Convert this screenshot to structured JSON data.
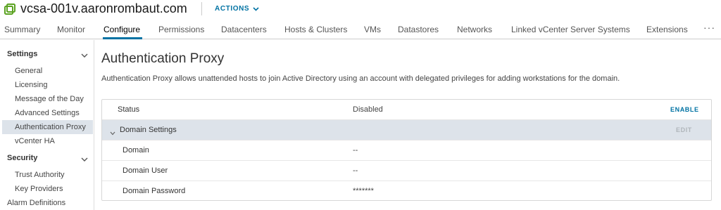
{
  "header": {
    "vm_icon": "vm-host-icon",
    "title": "vcsa-001v.aaronrombaut.com",
    "actions_label": "ACTIONS",
    "actions_icon": "chevron-down-icon"
  },
  "tabs": [
    {
      "label": "Summary"
    },
    {
      "label": "Monitor"
    },
    {
      "label": "Configure"
    },
    {
      "label": "Permissions"
    },
    {
      "label": "Datacenters"
    },
    {
      "label": "Hosts & Clusters"
    },
    {
      "label": "VMs"
    },
    {
      "label": "Datastores"
    },
    {
      "label": "Networks"
    },
    {
      "label": "Linked vCenter Server Systems"
    },
    {
      "label": "Extensions"
    }
  ],
  "tabs_more": "···",
  "active_tab": "Configure",
  "sidebar": {
    "settings_label": "Settings",
    "settings_items": [
      {
        "label": "General"
      },
      {
        "label": "Licensing"
      },
      {
        "label": "Message of the Day"
      },
      {
        "label": "Advanced Settings"
      },
      {
        "label": "Authentication Proxy"
      },
      {
        "label": "vCenter HA"
      }
    ],
    "security_label": "Security",
    "security_items": [
      {
        "label": "Trust Authority"
      },
      {
        "label": "Key Providers"
      }
    ],
    "alarm_label": "Alarm Definitions",
    "active_item": "Authentication Proxy"
  },
  "main": {
    "title": "Authentication Proxy",
    "description": "Authentication Proxy allows unattended hosts to join Active Directory using an account with delegated privileges for adding workstations for the domain.",
    "status": {
      "label": "Status",
      "value": "Disabled",
      "action": "ENABLE"
    },
    "domain_settings": {
      "label": "Domain Settings",
      "action": "EDIT"
    },
    "rows": [
      {
        "label": "Domain",
        "value": "--"
      },
      {
        "label": "Domain User",
        "value": "--"
      },
      {
        "label": "Domain Password",
        "value": "*******"
      }
    ]
  },
  "colors": {
    "accent": "#0072a3",
    "vm_icon": "#5aa220",
    "selected_bg": "#dde3ea",
    "disabled_text": "#b0b6bb"
  }
}
